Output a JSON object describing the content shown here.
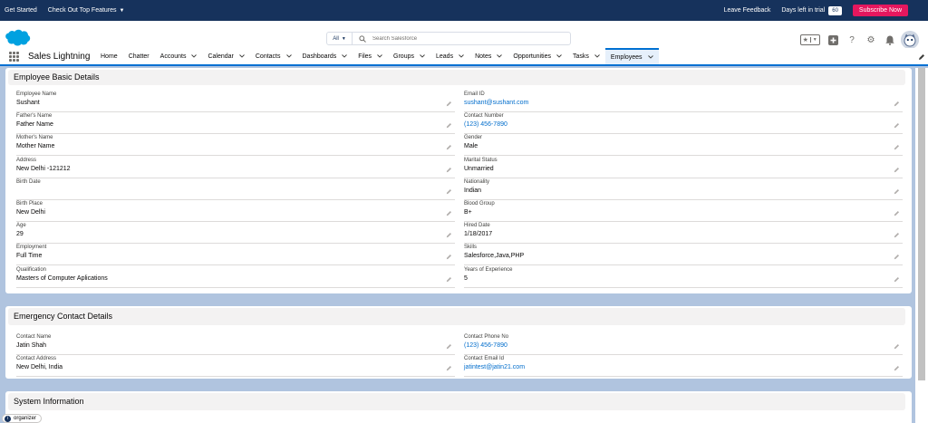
{
  "trial_bar": {
    "get_started": "Get Started",
    "top_features": "Check Out Top Features",
    "leave_feedback": "Leave Feedback",
    "days_left_label": "Days left in trial",
    "days_left_value": "60",
    "subscribe": "Subscribe Now"
  },
  "header": {
    "search_scope": "All",
    "search_placeholder": "Search Salesforce"
  },
  "nav": {
    "app_name": "Sales Lightning",
    "items": [
      {
        "label": "Home"
      },
      {
        "label": "Chatter"
      },
      {
        "label": "Accounts"
      },
      {
        "label": "Calendar"
      },
      {
        "label": "Contacts"
      },
      {
        "label": "Dashboards"
      },
      {
        "label": "Files"
      },
      {
        "label": "Groups"
      },
      {
        "label": "Leads"
      },
      {
        "label": "Notes"
      },
      {
        "label": "Opportunities"
      },
      {
        "label": "Tasks"
      },
      {
        "label": "Employees"
      }
    ]
  },
  "basic": {
    "title": "Employee Basic Details",
    "left": [
      {
        "label": "Employee Name",
        "value": "Sushant"
      },
      {
        "label": "Father's Name",
        "value": "Father Name"
      },
      {
        "label": "Mother's Name",
        "value": "Mother Name"
      },
      {
        "label": "Address",
        "value": "New Delhi -121212"
      },
      {
        "label": "Birth Date",
        "value": ""
      },
      {
        "label": "Birth Place",
        "value": "New Delhi"
      },
      {
        "label": "Age",
        "value": "29"
      },
      {
        "label": "Employment",
        "value": "Full Time"
      },
      {
        "label": "Qualification",
        "value": "Masters of Computer Aplications"
      }
    ],
    "right": [
      {
        "label": "Email ID",
        "value": "sushant@sushant.com"
      },
      {
        "label": "Contact Number",
        "value": "(123) 456-7890"
      },
      {
        "label": "Gender",
        "value": "Male"
      },
      {
        "label": "Marital Status",
        "value": "Unmarried"
      },
      {
        "label": "Nationality",
        "value": "Indian"
      },
      {
        "label": "Blood Group",
        "value": "B+"
      },
      {
        "label": "Hired Date",
        "value": "1/18/2017"
      },
      {
        "label": "Skills",
        "value": "Salesforce,Java,PHP"
      },
      {
        "label": "Years of Experience",
        "value": "5"
      }
    ]
  },
  "emergency": {
    "title": "Emergency Contact Details",
    "left": [
      {
        "label": "Contact Name",
        "value": "Jatin Shah"
      },
      {
        "label": "Contact Address",
        "value": "New Delhi, India"
      }
    ],
    "right": [
      {
        "label": "Contact Phone No",
        "value": "(123) 456-7890"
      },
      {
        "label": "Contact Email Id",
        "value": "jatintest@jatin21.com"
      }
    ]
  },
  "system": {
    "title": "System Information"
  },
  "organizer": {
    "label": "organizer"
  },
  "colors": {
    "header_bg": "#16325c",
    "subscribe_bg": "#e5175e",
    "link": "#006dcc",
    "page_bg": "#b0c4df"
  }
}
